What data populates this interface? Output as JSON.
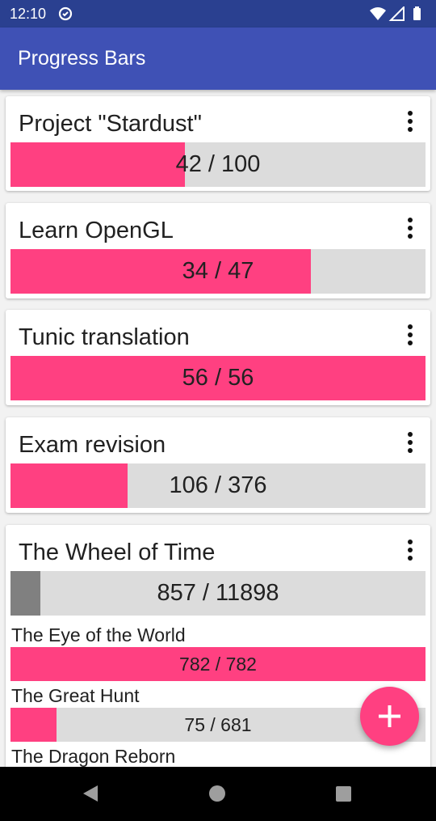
{
  "status_bar": {
    "time": "12:10"
  },
  "app_bar": {
    "title": "Progress Bars"
  },
  "projects": [
    {
      "title": "Project \"Stardust\"",
      "progress_text": "42 / 100",
      "current": 42,
      "total": 100
    },
    {
      "title": "Learn OpenGL",
      "progress_text": "34 / 47",
      "current": 34,
      "total": 47
    },
    {
      "title": "Tunic translation",
      "progress_text": "56 / 56",
      "current": 56,
      "total": 56
    },
    {
      "title": "Exam revision",
      "progress_text": "106 / 376",
      "current": 106,
      "total": 376
    },
    {
      "title": "The Wheel of Time",
      "progress_text": "857 / 11898",
      "current": 857,
      "total": 11898,
      "subtasks": [
        {
          "title": "The Eye of the World",
          "progress_text": "782 / 782",
          "current": 782,
          "total": 782
        },
        {
          "title": "The Great Hunt",
          "progress_text": "75 / 681",
          "current": 75,
          "total": 681
        },
        {
          "title": "The Dragon Reborn"
        }
      ]
    }
  ],
  "icons": {
    "status_left": "data-saver-icon",
    "wifi": "wifi-icon",
    "signal": "signal-icon",
    "battery": "battery-icon",
    "menu": "more-vert-icon",
    "fab": "add-icon",
    "nav_back": "back-icon",
    "nav_home": "home-icon",
    "nav_recents": "recents-icon"
  },
  "colors": {
    "app_bar": "#3f51b5",
    "status_bar": "#2a4090",
    "accent": "#ff4081",
    "track": "#dcdcdc",
    "parent_fill": "#808080"
  }
}
